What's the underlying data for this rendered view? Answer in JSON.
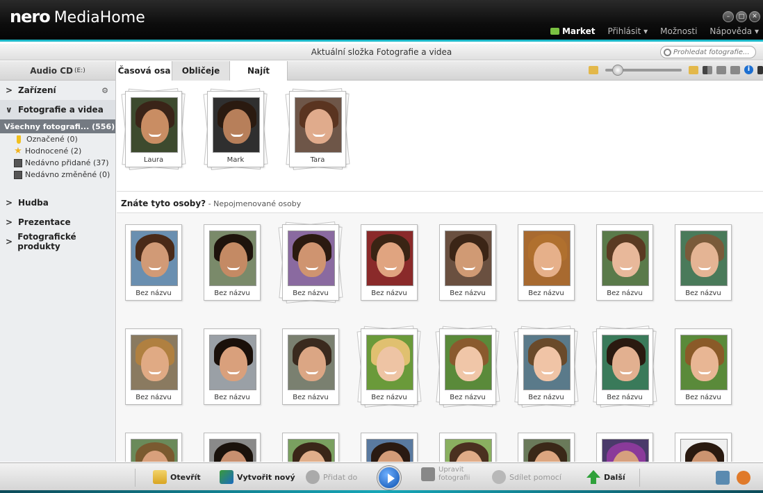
{
  "app": {
    "logo_brand": "nero",
    "logo_product": "MediaHome"
  },
  "menu": {
    "market": "Market",
    "login": "Přihlásit ▾",
    "options": "Možnosti",
    "help": "Nápověda ▾"
  },
  "folder": {
    "title": "Aktuální složka Fotografie a videa",
    "search_placeholder": "Prohledat fotografie..."
  },
  "sidebar": {
    "audio_cd": "Audio CD",
    "audio_cd_drive": "(E:)",
    "devices": "Zařízení",
    "photos_videos": "Fotografie a videa",
    "all_photos": "Všechny fotografi... (556)",
    "items": [
      "Označené (0)",
      "Hodnocené (2)",
      "Nedávno přidané (37)",
      "Nedávno změněné (0)"
    ],
    "music": "Hudba",
    "presentations": "Prezentace",
    "photo_products": "Fotografické produkty"
  },
  "tabs": [
    "Časová osa",
    "Obličeje",
    "Najít"
  ],
  "named_people": [
    {
      "name": "Laura",
      "skin": "#c98d63",
      "hair": "#3a2418",
      "bg": "#3d4a2e"
    },
    {
      "name": "Mark",
      "skin": "#b77f5a",
      "hair": "#2a1a10",
      "bg": "#2f2f2f"
    },
    {
      "name": "Tara",
      "skin": "#e0ab8c",
      "hair": "#5a3420",
      "bg": "#6e5648"
    }
  ],
  "section": {
    "title": "Znáte tyto osoby?",
    "subtitle": "- Nepojmenované osoby"
  },
  "unnamed_label": "Bez názvu",
  "unnamed_people": [
    {
      "skin": "#d19a76",
      "hair": "#4a2a18",
      "bg": "#6a8fb0"
    },
    {
      "skin": "#c48a64",
      "hair": "#1e130c",
      "bg": "#7a8a6a"
    },
    {
      "skin": "#cf9470",
      "hair": "#2a1a10",
      "bg": "#8a6aa0"
    },
    {
      "skin": "#e0a480",
      "hair": "#3a2414",
      "bg": "#8a2a2a"
    },
    {
      "skin": "#d09a74",
      "hair": "#3b2516",
      "bg": "#6a5040"
    },
    {
      "skin": "#e6b08a",
      "hair": "#b0702e",
      "bg": "#a86a30"
    },
    {
      "skin": "#e8b89a",
      "hair": "#5a3a22",
      "bg": "#5a7a4a"
    },
    {
      "skin": "#e4b494",
      "hair": "#7a5a3a",
      "bg": "#4a7a5a"
    },
    {
      "skin": "#e0aa84",
      "hair": "#b08040",
      "bg": "#8a7a60"
    },
    {
      "skin": "#d9a07c",
      "hair": "#1a100a",
      "bg": "#9aa0a6"
    },
    {
      "skin": "#dba684",
      "hair": "#3a2a1e",
      "bg": "#7a8070"
    },
    {
      "skin": "#eec4a4",
      "hair": "#e0c070",
      "bg": "#6a9a3a"
    },
    {
      "skin": "#f0c6a8",
      "hair": "#8a5a2e",
      "bg": "#5a8a3a"
    },
    {
      "skin": "#f0c4a6",
      "hair": "#6a4a2a",
      "bg": "#5a7a8a"
    },
    {
      "skin": "#e2b090",
      "hair": "#2a1a10",
      "bg": "#3a7a5a"
    },
    {
      "skin": "#e8b694",
      "hair": "#8a5a28",
      "bg": "#5a8a3a"
    },
    {
      "skin": "#d8a07c",
      "hair": "#7a5a30",
      "bg": "#6a8a5a"
    },
    {
      "skin": "#c89070",
      "hair": "#1a120c",
      "bg": "#8a8a8a"
    },
    {
      "skin": "#e0ae8a",
      "hair": "#3a2618",
      "bg": "#7aa060"
    },
    {
      "skin": "#d49c78",
      "hair": "#2a1a12",
      "bg": "#5a7aa0"
    },
    {
      "skin": "#e0ac88",
      "hair": "#4a3020",
      "bg": "#8ab060"
    },
    {
      "skin": "#dca680",
      "hair": "#3a2818",
      "bg": "#6a7a5a"
    },
    {
      "skin": "#d6a07e",
      "hair": "#8a3a9a",
      "bg": "#4a3a6a"
    },
    {
      "skin": "#cc9470",
      "hair": "#2a1a10",
      "bg": "#f0f0f0"
    }
  ],
  "bottom": {
    "open": "Otevřít",
    "create_new": "Vytvořit nový",
    "add_to": "Přidat do",
    "edit_photos_1": "Upravit",
    "edit_photos_2": "fotografii",
    "share": "Sdílet pomocí",
    "next": "Další"
  }
}
